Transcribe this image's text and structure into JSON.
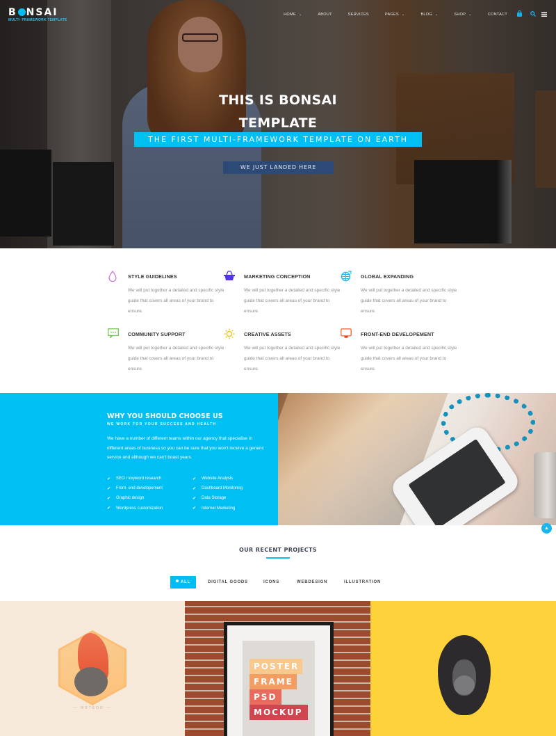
{
  "brand": {
    "name_pre": "B",
    "name_post": "NSAI",
    "tagline": "MULTI- FRAMEWORK TEMPLATE",
    "accent": "#00BFF3"
  },
  "nav": {
    "items": [
      {
        "label": "HOME",
        "has_dropdown": true
      },
      {
        "label": "ABOUT",
        "has_dropdown": false
      },
      {
        "label": "SERVICES",
        "has_dropdown": false
      },
      {
        "label": "PAGES",
        "has_dropdown": true
      },
      {
        "label": "BLOG",
        "has_dropdown": true
      },
      {
        "label": "SHOP",
        "has_dropdown": true
      },
      {
        "label": "CONTACT",
        "has_dropdown": false
      }
    ],
    "icons": [
      "cart-icon",
      "search-icon",
      "menu-icon"
    ]
  },
  "hero": {
    "title_line1": "THIS IS BONSAI",
    "title_line2": "TEMPLATE",
    "subtitle": "THE FIRST MULTI-FRAMEWORK TEMPLATE ON EARTH",
    "button": "WE JUST LANDED HERE"
  },
  "features": [
    {
      "icon": "drop-icon",
      "color": "#D36BE0",
      "title": "STYLE GUIDELINES",
      "text": "We will put together a detailed and specific style guide that covers all areas of your brand to ensure."
    },
    {
      "icon": "basket-icon",
      "color": "#5533E6",
      "title": "MARKETING CONCEPTION",
      "text": "We will put together a detailed and specific style guide that covers all areas of your brand to ensure."
    },
    {
      "icon": "globe-icon",
      "color": "#22B7EE",
      "title": "GLOBAL EXPANDING",
      "text": "We will put together a detailed and specific style guide that covers all areas of your brand to ensure."
    },
    {
      "icon": "chat-icon",
      "color": "#6CC04A",
      "title": "COMMUNITY SUPPORT",
      "text": "We will put together a detailed and specific style guide that covers all areas of your brand to ensure."
    },
    {
      "icon": "sun-icon",
      "color": "#F4C21A",
      "title": "CREATIVE ASSETS",
      "text": "We will put together a detailed and specific style guide that covers all areas of your brand to ensure."
    },
    {
      "icon": "monitor-icon",
      "color": "#F2693A",
      "title": "FRONT-END DEVELOPEMENT",
      "text": "We will put together a detailed and specific style guide that covers all areas of your brand to ensure."
    }
  ],
  "why": {
    "title": "WHY YOU SHOULD CHOOSE US",
    "subtitle": "WE WORK FOR YOUR SUCCESS AND HEALTH",
    "text": "We have a number of different teams within our agency that specialise in different areas of business so you can be sure that you won't receive a generic service and although we can't boast years.",
    "list_left": [
      "SEO / keyword research",
      "Front- end developement",
      "Graphic design",
      "Wordpress customization"
    ],
    "list_right": [
      "Website Analysis",
      "Dashboard Monitoring",
      "Data Storage",
      "Internet Marketing"
    ]
  },
  "projects": {
    "title": "OUR RECENT PROJECTS",
    "filters": [
      "ALL",
      "DIGITAL GOODS",
      "ICONS",
      "WEBDESIGN",
      "ILLUSTRATION"
    ],
    "active_filter": "ALL",
    "tiles": [
      {
        "name": "meteor",
        "caption": "METEOR"
      },
      {
        "name": "poster-frame",
        "lines": [
          "POSTER",
          "FRAME",
          "PSD",
          "MOCKUP"
        ]
      },
      {
        "name": "gorilla"
      }
    ]
  }
}
